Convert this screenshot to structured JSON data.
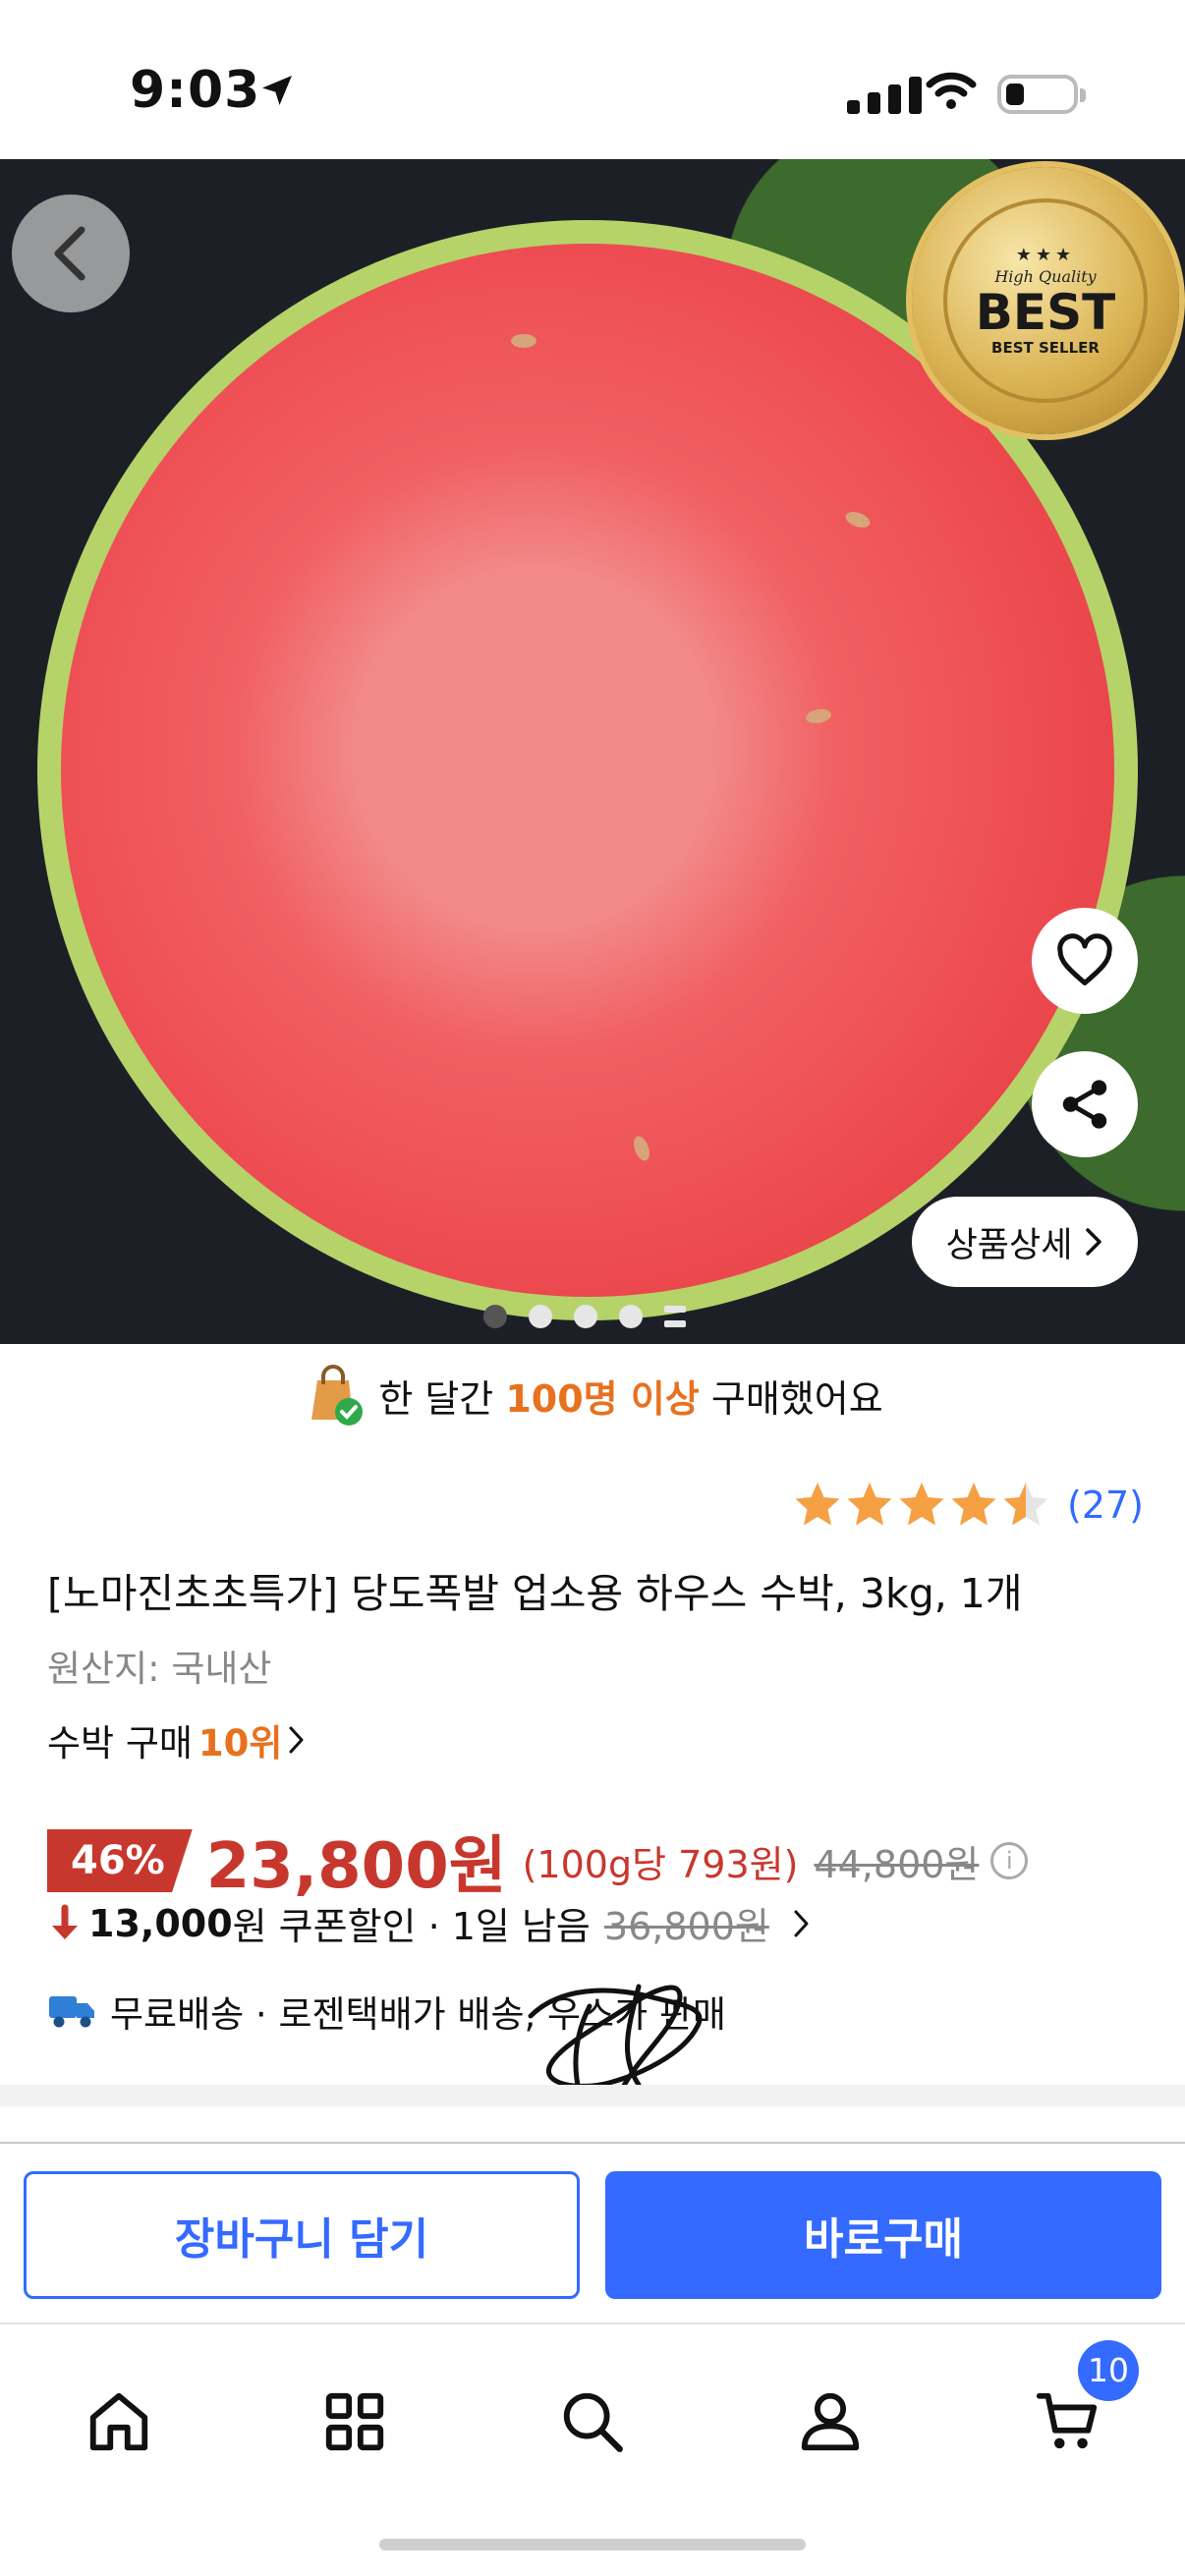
{
  "status_bar": {
    "time": "9:03"
  },
  "hero": {
    "badge": {
      "stars": "★★★",
      "quality": "High Quality",
      "title": "BEST",
      "subtitle": "BEST SELLER"
    },
    "detail_button": "상품상세",
    "carousel": {
      "total_dots": 5,
      "active_index": 0
    }
  },
  "purchase_note": {
    "prefix": "한 달간 ",
    "highlight": "100명 이상",
    "suffix": " 구매했어요"
  },
  "rating": {
    "stars": 4.5,
    "count": "(27)"
  },
  "product": {
    "title": "[노마진초초특가] 당도폭발 업소용 하우스 수박, 3kg, 1개",
    "origin": "원산지: 국내산",
    "rank_prefix": "수박 구매 ",
    "rank_value": "10위"
  },
  "pricing": {
    "discount": "46%",
    "price": "23,800원",
    "unit_price": "(100g당 793원)",
    "original_price": "44,800원",
    "coupon_amount": "13,000",
    "coupon_text": "원 쿠폰할인 · 1일 남음",
    "coupon_original": "36,800원"
  },
  "delivery": {
    "text": "무료배송 · 로젠택배가 배송, 우스가 판매"
  },
  "actions": {
    "cart_label": "장바구니 담기",
    "buy_label": "바로구매"
  },
  "bottom_nav": {
    "cart_badge": "10"
  },
  "colors": {
    "accent": "#346aff",
    "price_red": "#c8372d",
    "highlight_orange": "#e8711e"
  }
}
